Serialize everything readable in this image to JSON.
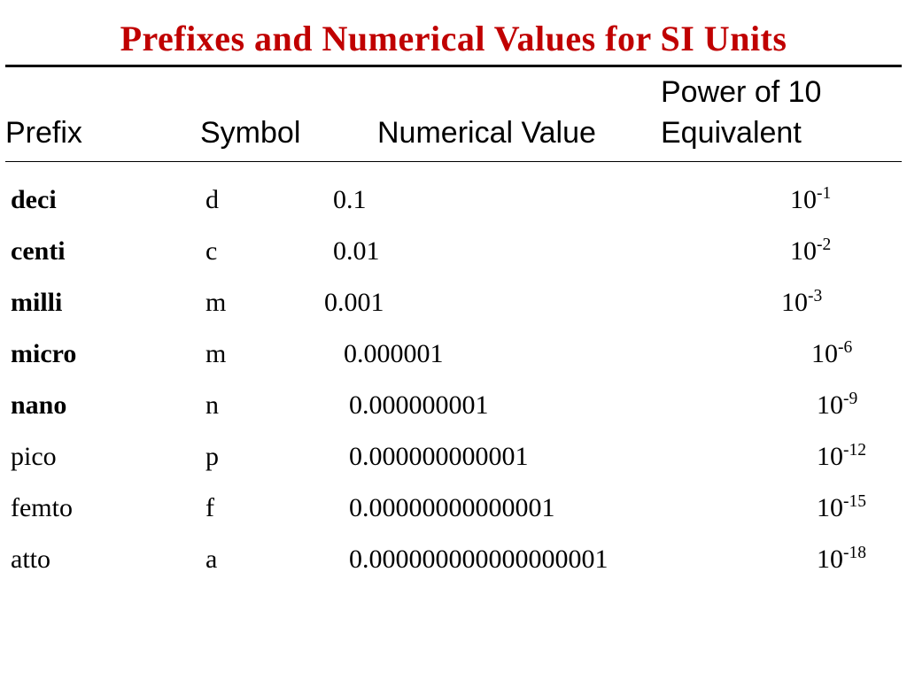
{
  "title": "Prefixes and Numerical Values for SI Units",
  "header": {
    "powerTop": "Power of 10",
    "prefix": "Prefix",
    "symbol": "Symbol",
    "numval": "Numerical Value",
    "equiv": "Equivalent"
  },
  "rows": [
    {
      "prefix": "deci",
      "bold": true,
      "symbol": "d",
      "numval": "0.1",
      "base": "10",
      "exp": "-1",
      "numpad": 24,
      "powpad": 16
    },
    {
      "prefix": "centi",
      "bold": true,
      "symbol": "c",
      "numval": "0.01",
      "base": "10",
      "exp": "-2",
      "numpad": 24,
      "powpad": 16
    },
    {
      "prefix": "milli",
      "bold": true,
      "symbol": "m",
      "numval": "0.001",
      "base": "10",
      "exp": "-3",
      "numpad": 14,
      "powpad": 16
    },
    {
      "prefix": "micro",
      "bold": true,
      "symbol": "m",
      "numval": "0.000001",
      "base": "10",
      "exp": "-6",
      "numpad": 36,
      "powpad": 28
    },
    {
      "prefix": "nano",
      "bold": true,
      "symbol": "n",
      "numval": "0.000000001",
      "base": "10",
      "exp": "-9",
      "numpad": 42,
      "powpad": 28
    },
    {
      "prefix": "pico",
      "bold": false,
      "symbol": "p",
      "numval": "0.000000000001",
      "base": "10",
      "exp": "-12",
      "numpad": 42,
      "powpad": 28
    },
    {
      "prefix": "femto",
      "bold": false,
      "symbol": "f",
      "numval": "0.00000000000001",
      "base": "10",
      "exp": "-15",
      "numpad": 42,
      "powpad": 28
    },
    {
      "prefix": "atto",
      "bold": false,
      "symbol": "a",
      "numval": "0.000000000000000001",
      "base": "10",
      "exp": "-18",
      "numpad": 42,
      "powpad": 28
    }
  ]
}
